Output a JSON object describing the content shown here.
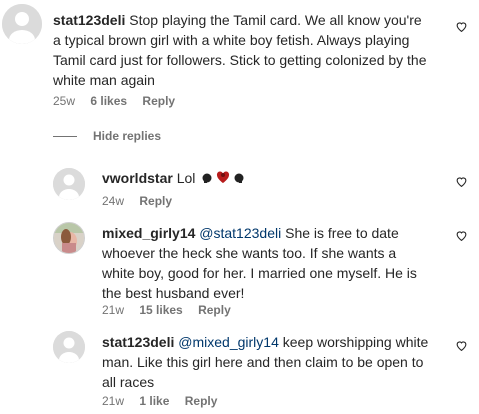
{
  "comments": [
    {
      "username": "stat123deli",
      "text": "Stop playing the Tamil card. We all know you're a typical brown girl with a white boy fetish. Always playing Tamil card just for followers. Stick to getting colonized by the white man again",
      "time": "25w",
      "likes": "6 likes",
      "reply": "Reply"
    }
  ],
  "hide_replies": "Hide replies",
  "replies": [
    {
      "username": "vworldstar",
      "text": "Lol",
      "emojis": [
        "punch-emoji",
        "poop-heart-emoji",
        "punch-emoji"
      ],
      "time": "24w",
      "reply": "Reply"
    },
    {
      "username": "mixed_girly14",
      "mention": "@stat123deli",
      "text": "She is free to date whoever the heck she wants too. If she wants a white boy, good for her. I married one myself. He is the best husband ever!",
      "time": "21w",
      "likes": "15 likes",
      "reply": "Reply"
    },
    {
      "username": "stat123deli",
      "mention": "@mixed_girly14",
      "text": "keep worshipping white man. Like this girl here and then claim to be open to all races",
      "time": "21w",
      "likes": "1 like",
      "reply": "Reply"
    }
  ]
}
